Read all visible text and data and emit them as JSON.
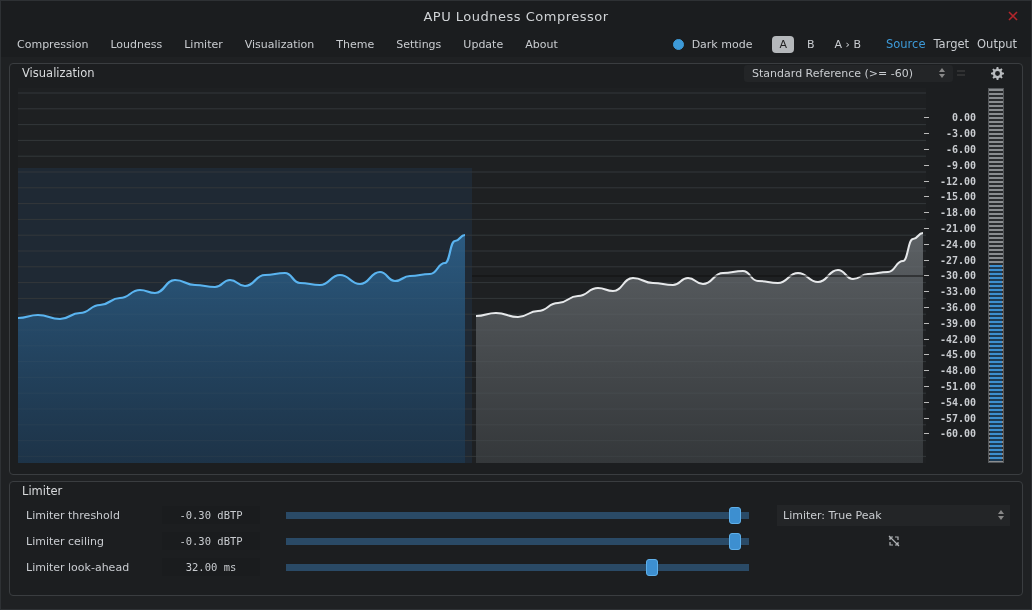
{
  "window": {
    "title": "APU Loudness Compressor"
  },
  "menu": [
    {
      "label": "Compression"
    },
    {
      "label": "Loudness"
    },
    {
      "label": "Limiter"
    },
    {
      "label": "Visualization"
    },
    {
      "label": "Theme"
    },
    {
      "label": "Settings"
    },
    {
      "label": "Update"
    },
    {
      "label": "About"
    }
  ],
  "dark_mode": {
    "label": "Dark mode",
    "checked": true
  },
  "ab_buttons": [
    {
      "label": "A",
      "selected": true
    },
    {
      "label": "B",
      "selected": false
    },
    {
      "label": "A › B",
      "selected": false
    }
  ],
  "view_buttons": [
    {
      "label": "Source",
      "selected": true
    },
    {
      "label": "Target",
      "selected": false
    },
    {
      "label": "Output",
      "selected": false
    }
  ],
  "visualization": {
    "title": "Visualization",
    "reference": "Standard Reference (>= -60)",
    "scale": [
      "0.00",
      "-3.00",
      "-6.00",
      "-9.00",
      "-12.00",
      "-15.00",
      "-18.00",
      "-21.00",
      "-24.00",
      "-27.00",
      "-30.00",
      "-33.00",
      "-36.00",
      "-39.00",
      "-42.00",
      "-45.00",
      "-48.00",
      "-51.00",
      "-54.00",
      "-57.00",
      "-60.00"
    ],
    "meter": {
      "level": 0.53
    }
  },
  "limiter": {
    "title": "Limiter",
    "mode": "Limiter: True Peak",
    "controls": [
      {
        "label": "Limiter threshold",
        "value": "-0.30 dBTP",
        "level": 0.97
      },
      {
        "label": "Limiter ceiling",
        "value": "-0.30 dBTP",
        "level": 0.97
      },
      {
        "label": "Limiter look-ahead",
        "value": "32.00 ms",
        "level": 0.79
      }
    ]
  }
}
